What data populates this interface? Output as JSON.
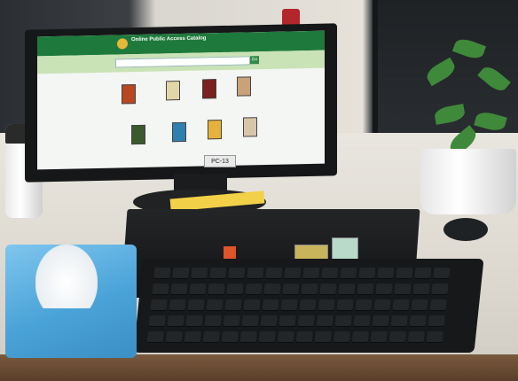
{
  "opac": {
    "site_title": "Online Public Access Catalog",
    "search_button": "Go",
    "sections": [
      {
        "books": [
          {
            "color": "#b9471f"
          },
          {
            "color": "#e1d6a8"
          },
          {
            "color": "#7b1f1f"
          },
          {
            "color": "#c9a27a"
          }
        ]
      },
      {
        "books": [
          {
            "color": "#3a5a2e"
          },
          {
            "color": "#2f7fb0"
          },
          {
            "color": "#e6b23b"
          },
          {
            "color": "#d8c6a8"
          }
        ]
      }
    ]
  },
  "monitor": {
    "tag": "PC-13"
  },
  "colors": {
    "header_green": "#1e7a3c",
    "search_band": "#c9e2b6",
    "tissue_blue": "#4aa3d8",
    "pc_accent_orange": "#e0542a"
  }
}
